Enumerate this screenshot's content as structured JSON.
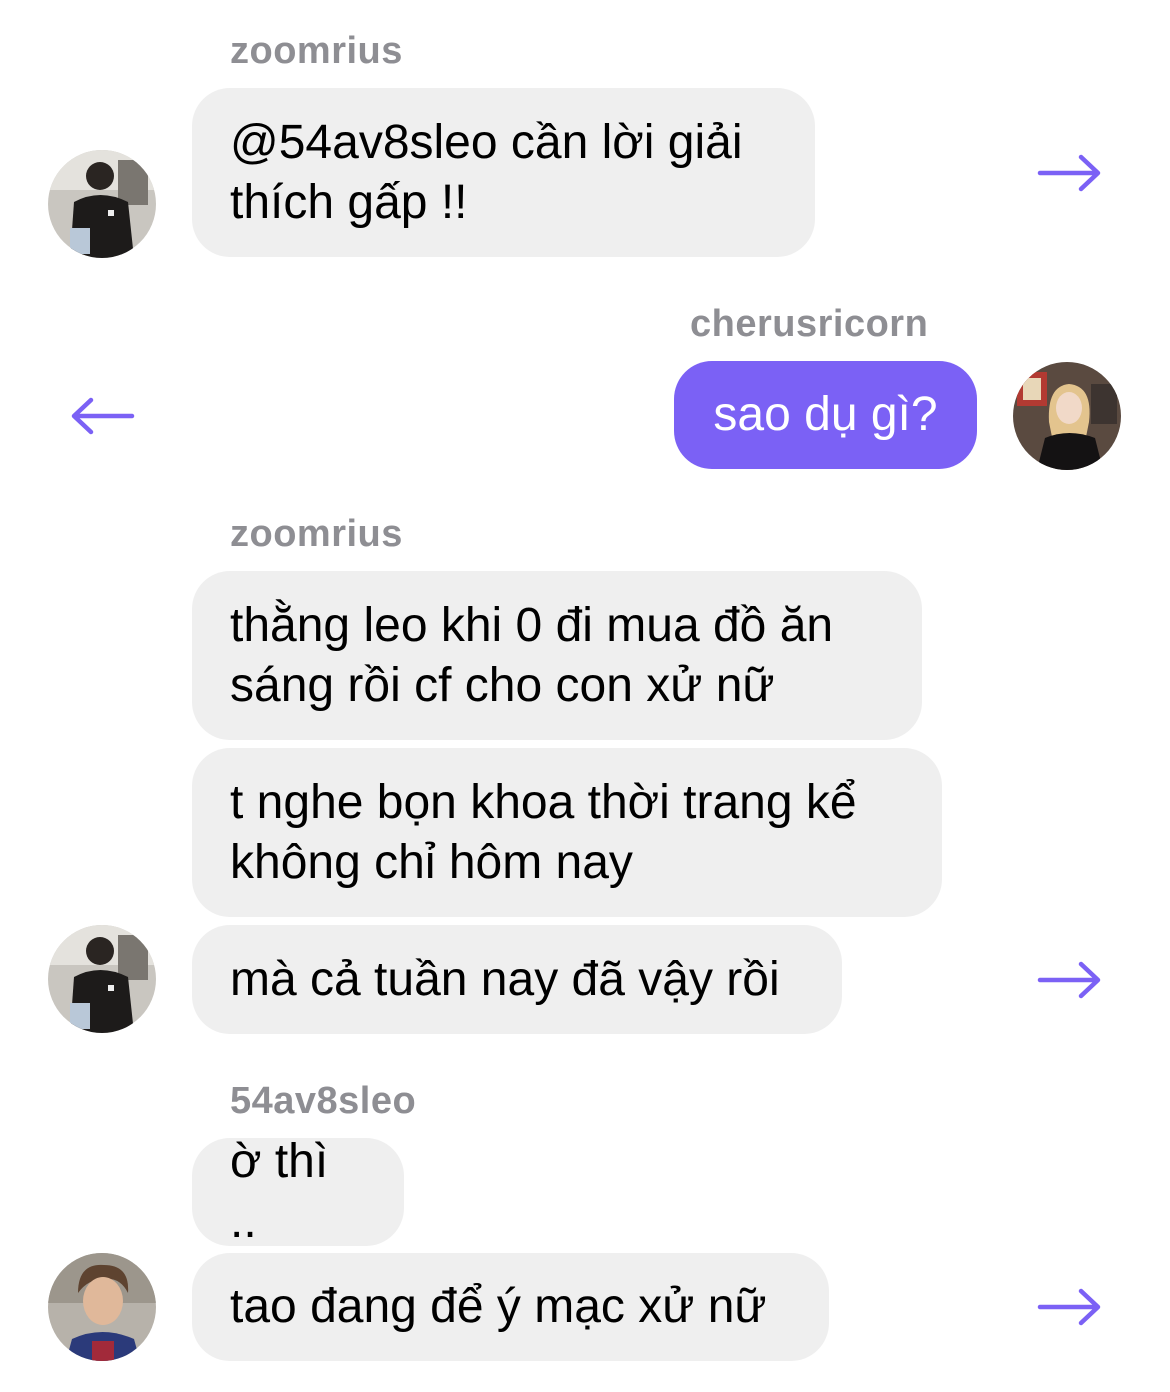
{
  "colors": {
    "accent": "#7b61f5",
    "incoming_bubble": "#efefef",
    "sender_text": "#8e8e93"
  },
  "messages": [
    {
      "sender": "zoomrius",
      "text": "@54av8sleo cần lời giải thích gấp !!",
      "direction": "incoming"
    },
    {
      "sender": "cherusricorn",
      "text": "sao dụ gì?",
      "direction": "outgoing"
    },
    {
      "sender": "zoomrius",
      "text": "thằng leo khi 0 đi mua đồ ăn sáng rồi cf cho con xử nữ",
      "direction": "incoming"
    },
    {
      "text": "t nghe bọn khoa thời trang kể không chỉ hôm nay",
      "direction": "incoming"
    },
    {
      "text": "mà cả tuần nay đã vậy rồi",
      "direction": "incoming"
    },
    {
      "sender": "54av8sleo",
      "text": "ờ thì ..",
      "direction": "incoming"
    },
    {
      "text": "tao đang để ý mạc xử nữ",
      "direction": "incoming"
    }
  ],
  "icons": {
    "forward": "arrow-right-icon",
    "reply": "arrow-left-icon"
  }
}
